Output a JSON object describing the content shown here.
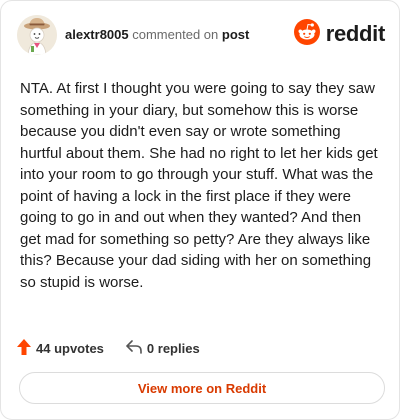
{
  "comment": {
    "username": "alextr8005",
    "action_text": "commented on",
    "post_link_label": "post",
    "body": "NTA. At first I thought you were going to say they saw something in your diary, but somehow this is worse because you didn't even say or wrote something hurtful about them. She had no right to let her kids get into your room to go through your stuff. What was the point of having a lock in the first place if they were going to go in and out when they wanted? And then get mad for something so petty? Are they always like this? Because your dad siding with her on something so stupid is worse."
  },
  "brand": {
    "wordmark": "reddit",
    "accent_color": "#ff4500"
  },
  "footer": {
    "upvotes_label": "44 upvotes",
    "replies_label": "0 replies",
    "view_more_label": "View more on Reddit"
  },
  "icons": {
    "avatar": "avatar-icon",
    "logo": "reddit-logo-icon",
    "upvote": "upvote-arrow-icon",
    "reply": "reply-arrow-icon"
  }
}
